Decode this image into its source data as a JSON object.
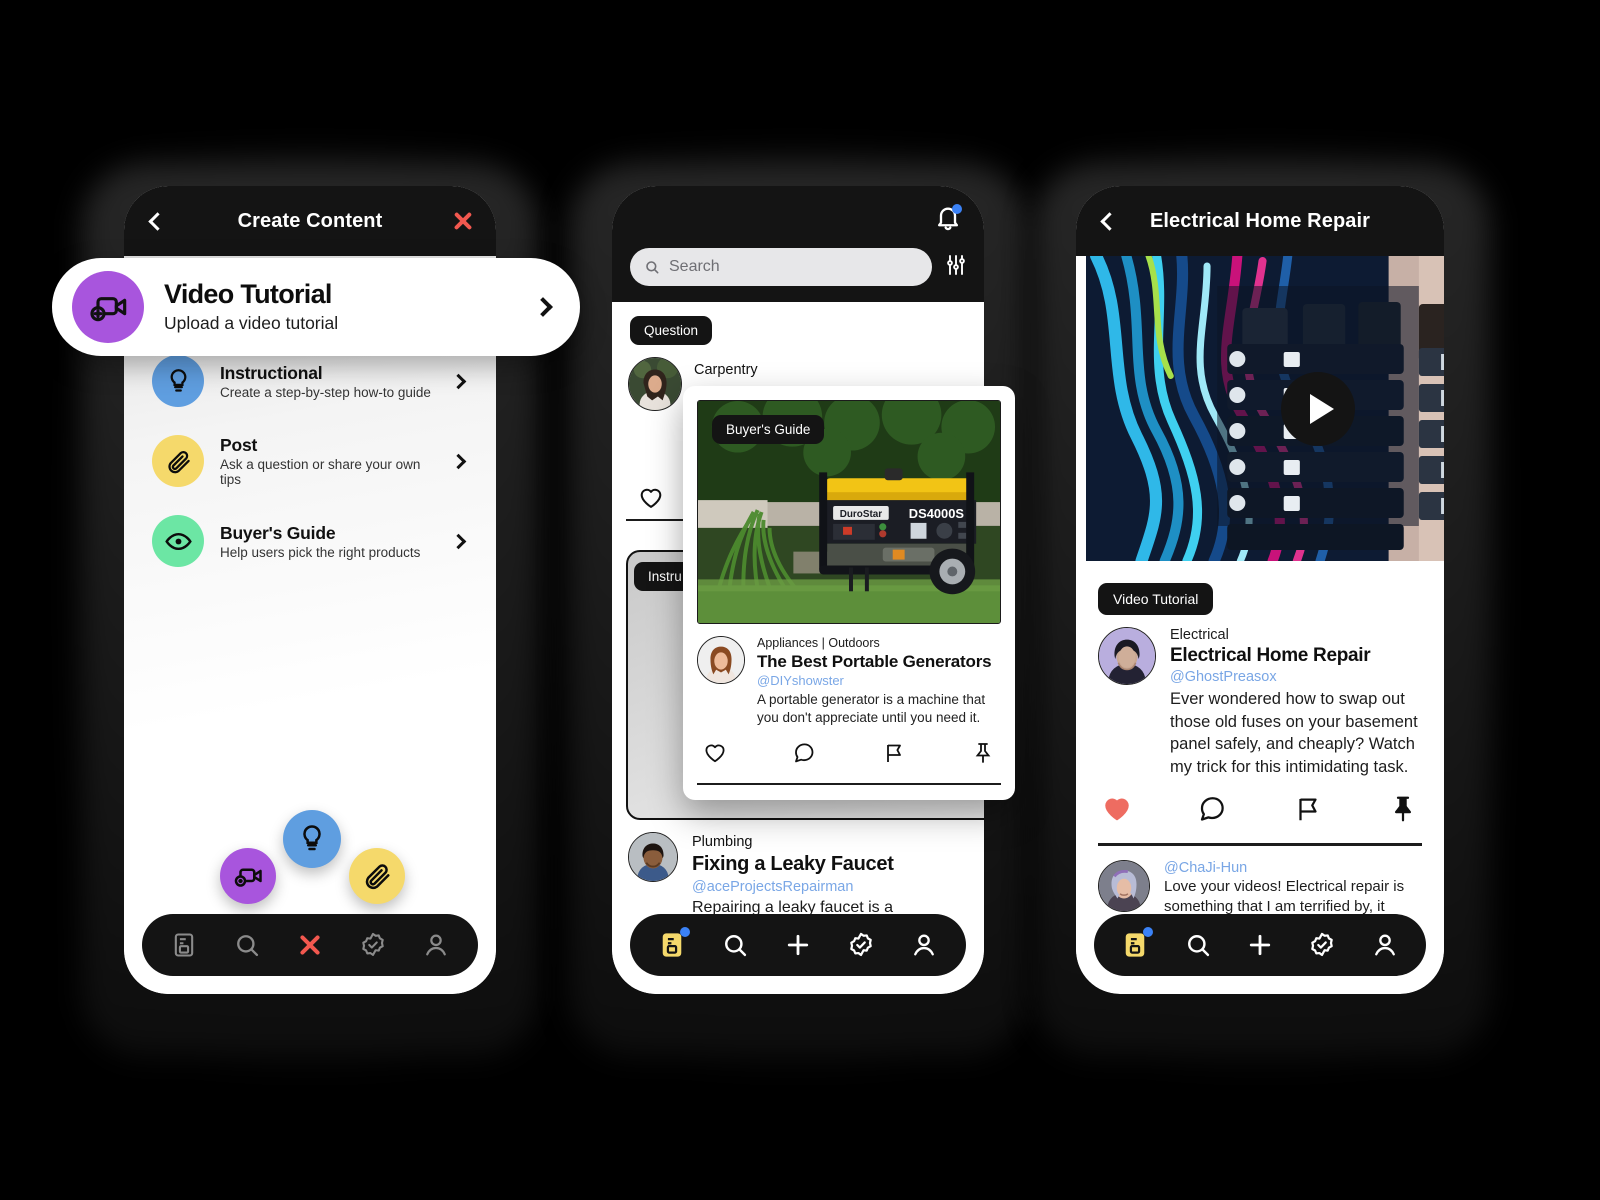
{
  "phone1": {
    "header": {
      "title": "Create Content",
      "back_icon": "chevron-left-icon",
      "close_icon": "close-x-icon"
    },
    "featured": {
      "title": "Video Tutorial",
      "subtitle": "Upload a video tutorial",
      "icon": "video-plus-icon",
      "color": "#a855dd",
      "chevron": "chevron-right-icon"
    },
    "options": [
      {
        "title": "Instructional",
        "subtitle": "Create a step-by-step how-to guide",
        "icon": "lightbulb-icon",
        "color": "#5f9ee0"
      },
      {
        "title": "Post",
        "subtitle": "Ask a question or share your own tips",
        "icon": "paperclip-icon",
        "color": "#f5d96b"
      },
      {
        "title": "Buyer's Guide",
        "subtitle": "Help users pick the right products",
        "icon": "eye-icon",
        "color": "#6ce6a4"
      }
    ],
    "fabs": [
      {
        "icon": "video-plus-icon",
        "color": "#a855dd"
      },
      {
        "icon": "lightbulb-icon",
        "color": "#5f9ee0"
      },
      {
        "icon": "paperclip-icon",
        "color": "#f5d96b"
      }
    ],
    "nav": [
      {
        "icon": "feed-icon",
        "active": false
      },
      {
        "icon": "search-icon",
        "active": false
      },
      {
        "icon": "close-x-icon",
        "active": true,
        "color": "#f2584f"
      },
      {
        "icon": "verified-badge-icon",
        "active": false
      },
      {
        "icon": "person-icon",
        "active": false
      }
    ]
  },
  "phone2": {
    "header": {
      "bell_icon": "bell-icon",
      "has_notification": true
    },
    "search": {
      "placeholder": "Search",
      "icon": "search-icon",
      "filter_icon": "sliders-icon"
    },
    "feed": [
      {
        "badge": "Question",
        "category": "Carpentry",
        "avatar": "woman-outdoors-avatar"
      },
      {
        "badge": "Instructional",
        "badge_truncated": "Instru",
        "category": "",
        "avatar": ""
      },
      {
        "badge": "",
        "category": "Plumbing",
        "title": "Fixing a Leaky Faucet",
        "handle": "@aceProjectsRepairman",
        "body": "Repairing a leaky faucet is a",
        "avatar": "man-blue-shirt-avatar"
      }
    ],
    "floating_card": {
      "badge": "Buyer's Guide",
      "image_label": "DuroStar DS4000S portable generator",
      "product_brand": "DuroStar",
      "product_model": "DS4000S",
      "category": "Appliances | Outdoors",
      "title": "The Best Portable Generators",
      "handle": "@DIYshowster",
      "body": "A portable generator is a machine that you don't appreciate until you need it.",
      "actions": [
        "heart-outline-icon",
        "comment-icon",
        "flag-icon",
        "pin-icon"
      ]
    },
    "nav": [
      {
        "icon": "feed-icon",
        "active": true,
        "color": "#f5d96b",
        "has_dot": true
      },
      {
        "icon": "search-icon",
        "active": false
      },
      {
        "icon": "plus-icon",
        "active": false
      },
      {
        "icon": "verified-badge-icon",
        "active": false
      },
      {
        "icon": "person-icon",
        "active": false
      }
    ]
  },
  "phone3": {
    "header": {
      "title": "Electrical Home Repair",
      "back_icon": "chevron-left-icon"
    },
    "video": {
      "play_icon": "play-icon",
      "image_label": "electrical breaker panel with colored wires"
    },
    "badge": "Video Tutorial",
    "post": {
      "category": "Electrical",
      "title": "Electrical Home Repair",
      "handle": "@GhostPreasox",
      "body": "Ever wondered how to swap out those old fuses on your basement panel safely, and cheaply? Watch my trick for this intimidating task.",
      "avatar": "woman-purple-avatar",
      "actions": [
        {
          "icon": "heart-filled-icon",
          "active": true,
          "color": "#ee6c61"
        },
        {
          "icon": "comment-icon",
          "active": false
        },
        {
          "icon": "flag-icon",
          "active": false
        },
        {
          "icon": "pin-icon",
          "active": false
        }
      ]
    },
    "comment": {
      "handle": "@ChaJi-Hun",
      "body": "Love your videos! Electrical repair is something that I am terrified by, it helps to know the right ways to do it.",
      "avatar": "woman-silver-hair-avatar"
    },
    "nav": [
      {
        "icon": "feed-icon",
        "active": true,
        "color": "#f5d96b",
        "has_dot": true
      },
      {
        "icon": "search-icon",
        "active": false
      },
      {
        "icon": "plus-icon",
        "active": false
      },
      {
        "icon": "verified-badge-icon",
        "active": false
      },
      {
        "icon": "person-icon",
        "active": false
      }
    ]
  }
}
